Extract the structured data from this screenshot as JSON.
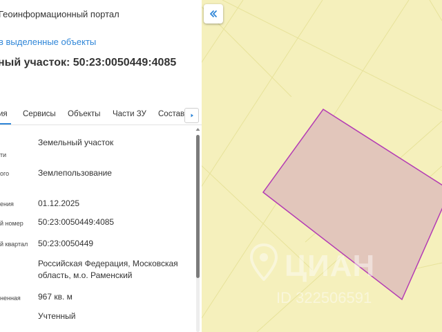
{
  "header": {
    "portal_title": "Геоинформационный портал",
    "back_link": "в выделенные объекты",
    "parcel_title": "ный участок: 50:23:0050449:4085"
  },
  "tabs": [
    {
      "label": "ия",
      "active": true
    },
    {
      "label": "Сервисы",
      "active": false
    },
    {
      "label": "Объекты",
      "active": false
    },
    {
      "label": "Части ЗУ",
      "active": false
    },
    {
      "label": "Состав",
      "active": false
    }
  ],
  "properties": [
    {
      "label": "ти",
      "value": "Земельный участок"
    },
    {
      "label": "ого",
      "value": "Землепользование"
    },
    {
      "label": "ения",
      "value": "01.12.2025"
    },
    {
      "label": "й номер",
      "value": "50:23:0050449:4085"
    },
    {
      "label": "й квартал",
      "value": "50:23:0050449"
    },
    {
      "label": "",
      "value": "Российская Федерация, Московская область, м.о. Раменский"
    },
    {
      "label": "ненная",
      "value": "967 кв. м"
    },
    {
      "label": "",
      "value": "Учтенный"
    }
  ],
  "map": {
    "watermark_text": "ЦИАН",
    "watermark_id": "ID 322506591",
    "background_color": "#f5f0bc",
    "parcel_fill": "#e2c6bb",
    "parcel_stroke": "#b43cb4",
    "boundary_line_color": "#e7e29a"
  },
  "icons": {
    "collapse": "double-chevron-left-icon",
    "tab_scroll": "caret-right-icon",
    "watermark_logo": "location-pin-icon"
  },
  "colors": {
    "accent": "#2f86d8",
    "scroll_thumb": "#7b7b7b"
  }
}
